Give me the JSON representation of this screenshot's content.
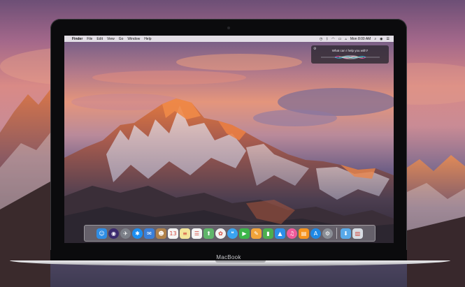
{
  "menubar": {
    "apple_glyph": "",
    "items": [
      "Finder",
      "File",
      "Edit",
      "View",
      "Go",
      "Window",
      "Help"
    ],
    "status_icons": [
      "time-machine-icon",
      "bluetooth-icon",
      "wifi-icon",
      "battery-icon",
      "airplay-icon"
    ],
    "clock": "Mon 8:00 AM",
    "right_icons": [
      "spotlight-icon",
      "siri-icon",
      "notification-center-icon"
    ]
  },
  "siri": {
    "prompt": "What can I help you with?",
    "settings_icon": "gear-icon"
  },
  "laptop": {
    "brand": "MacBook"
  },
  "dock": {
    "apps": [
      {
        "name": "finder-icon",
        "glyph": "☺",
        "color": "#2f8de4",
        "shape": "square"
      },
      {
        "name": "siri-icon",
        "glyph": "◉",
        "color": "#3b2a6d",
        "shape": "round"
      },
      {
        "name": "launchpad-icon",
        "glyph": "✈",
        "color": "#7b7f88",
        "shape": "round"
      },
      {
        "name": "safari-icon",
        "glyph": "✱",
        "color": "#1c8ef0",
        "shape": "round"
      },
      {
        "name": "mail-icon",
        "glyph": "✉",
        "color": "#3a7fd8",
        "shape": "square"
      },
      {
        "name": "contacts-icon",
        "glyph": "☻",
        "color": "#b0824a",
        "shape": "square"
      },
      {
        "name": "calendar-icon",
        "glyph": "13",
        "color": "#f4f4f4",
        "shape": "square"
      },
      {
        "name": "notes-icon",
        "glyph": "≡",
        "color": "#f3e59a",
        "shape": "square"
      },
      {
        "name": "reminders-icon",
        "glyph": "☰",
        "color": "#f6f6f6",
        "shape": "square"
      },
      {
        "name": "maps-icon",
        "glyph": "⬆",
        "color": "#5fb56a",
        "shape": "square"
      },
      {
        "name": "photos-icon",
        "glyph": "✿",
        "color": "#f2f2f2",
        "shape": "round"
      },
      {
        "name": "messages-icon",
        "glyph": "❝",
        "color": "#3aa3f0",
        "shape": "round"
      },
      {
        "name": "facetime-icon",
        "glyph": "▶",
        "color": "#3cb54a",
        "shape": "square"
      },
      {
        "name": "pages-icon",
        "glyph": "✎",
        "color": "#f1a33a",
        "shape": "square"
      },
      {
        "name": "numbers-icon",
        "glyph": "▮",
        "color": "#4cae4f",
        "shape": "square"
      },
      {
        "name": "keynote-icon",
        "glyph": "▲",
        "color": "#2d8ee8",
        "shape": "square"
      },
      {
        "name": "itunes-icon",
        "glyph": "♫",
        "color": "#f05a9a",
        "shape": "round"
      },
      {
        "name": "ibooks-icon",
        "glyph": "▤",
        "color": "#f5931e",
        "shape": "square"
      },
      {
        "name": "app-store-icon",
        "glyph": "A",
        "color": "#1e88e5",
        "shape": "round"
      },
      {
        "name": "system-preferences-icon",
        "glyph": "⚙",
        "color": "#8a8e96",
        "shape": "round"
      }
    ],
    "trailing": [
      {
        "name": "downloads-folder-icon",
        "glyph": "⬇",
        "color": "#58a9e8",
        "shape": "square"
      },
      {
        "name": "trash-icon",
        "glyph": "▥",
        "color": "#d8dde4",
        "shape": "square"
      }
    ]
  }
}
